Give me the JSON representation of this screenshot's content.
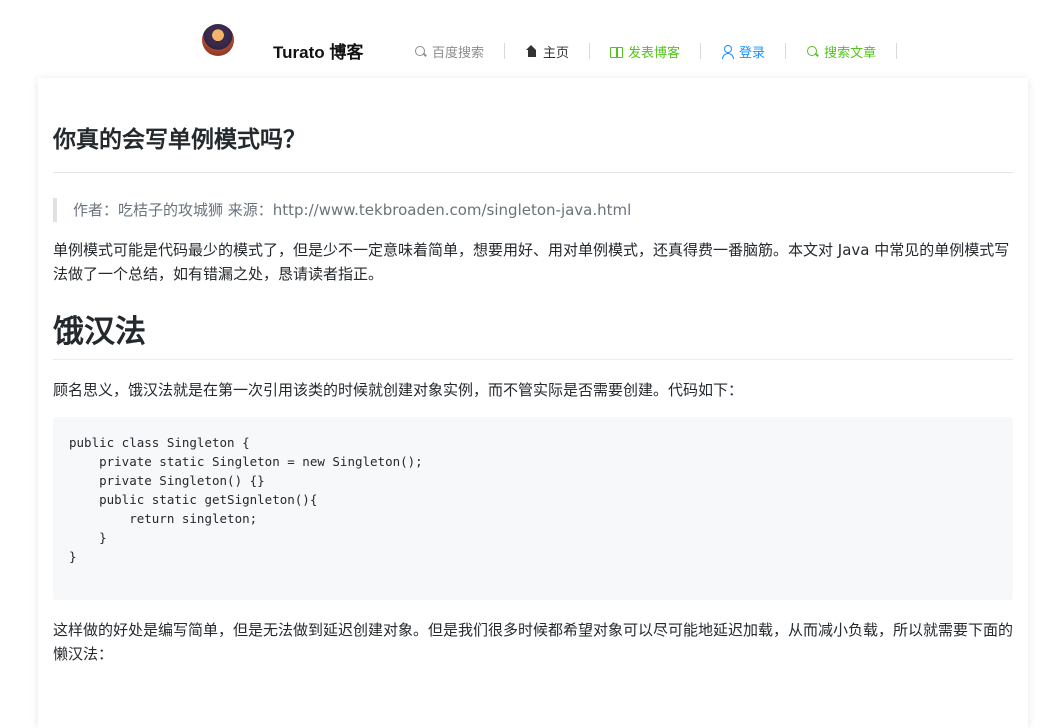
{
  "header": {
    "brand": "Turato 博客",
    "nav": [
      {
        "label": "百度搜索",
        "icon": "search-icon",
        "color": "#8c8c8c"
      },
      {
        "label": "主页",
        "icon": "home-icon",
        "color": "#333333"
      },
      {
        "label": "发表博客",
        "icon": "book-icon",
        "color": "#52c41a"
      },
      {
        "label": "登录",
        "icon": "user-icon",
        "color": "#1890ff"
      },
      {
        "label": "搜索文章",
        "icon": "search-icon",
        "color": "#52c41a"
      }
    ]
  },
  "article": {
    "title": "你真的会写单例模式吗？",
    "quote": "作者：吃桔子的攻城狮 来源：http://www.tekbroaden.com/singleton-java.html",
    "intro": "单例模式可能是代码最少的模式了，但是少不一定意味着简单，想要用好、用对单例模式，还真得费一番脑筋。本文对 Java 中常见的单例模式写法做了一个总结，如有错漏之处，恳请读者指正。",
    "section_heading": "饿汉法",
    "section_intro": "顾名思义，饿汉法就是在第一次引用该类的时候就创建对象实例，而不管实际是否需要创建。代码如下：",
    "code": "public class Singleton {\n    private static Singleton = new Singleton();\n    private Singleton() {}\n    public static getSignleton(){\n        return singleton;\n    }\n}",
    "after_code": "这样做的好处是编写简单，但是无法做到延迟创建对象。但是我们很多时候都希望对象可以尽可能地延迟加载，从而减小负载，所以就需要下面的懒汉法："
  }
}
